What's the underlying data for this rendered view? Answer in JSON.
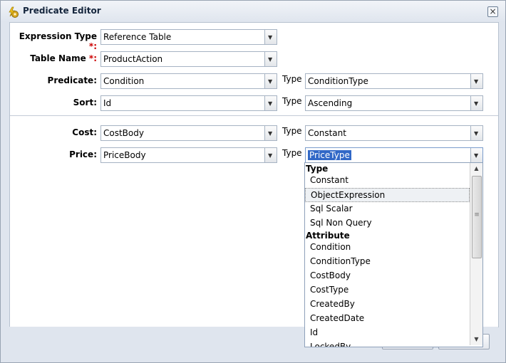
{
  "window": {
    "title": "Predicate Editor",
    "close_glyph": "×"
  },
  "form": {
    "expression_type": {
      "label": "Expression Type",
      "value": "Reference Table"
    },
    "table_name": {
      "label": "Table Name",
      "value": "ProductAction"
    },
    "predicate": {
      "label": "Predicate:",
      "value": "Condition",
      "type_label": "Type",
      "type_value": "ConditionType"
    },
    "sort": {
      "label": "Sort:",
      "value": "Id",
      "type_label": "Type",
      "type_value": "Ascending"
    },
    "cost": {
      "label": "Cost:",
      "value": "CostBody",
      "type_label": "Type",
      "type_value": "Constant"
    },
    "price": {
      "label": "Price:",
      "value": "PriceBody",
      "type_label": "Type",
      "type_value": "PriceType"
    },
    "required_mark": "*:"
  },
  "dropdown": {
    "groups": [
      {
        "header": "Type",
        "items": [
          "Constant",
          "ObjectExpression",
          "Sql Scalar",
          "Sql Non Query"
        ]
      },
      {
        "header": "Attribute",
        "items": [
          "Condition",
          "ConditionType",
          "CostBody",
          "CostType",
          "CreatedBy",
          "CreatedDate",
          "Id",
          "LockedBy"
        ]
      }
    ],
    "highlighted": "ObjectExpression"
  },
  "icons": {
    "title": "lightning-gear-icon",
    "combo_trigger": "chevron-down-icon",
    "scroll_up": "arrow-up-icon",
    "scroll_down": "arrow-down-icon"
  }
}
